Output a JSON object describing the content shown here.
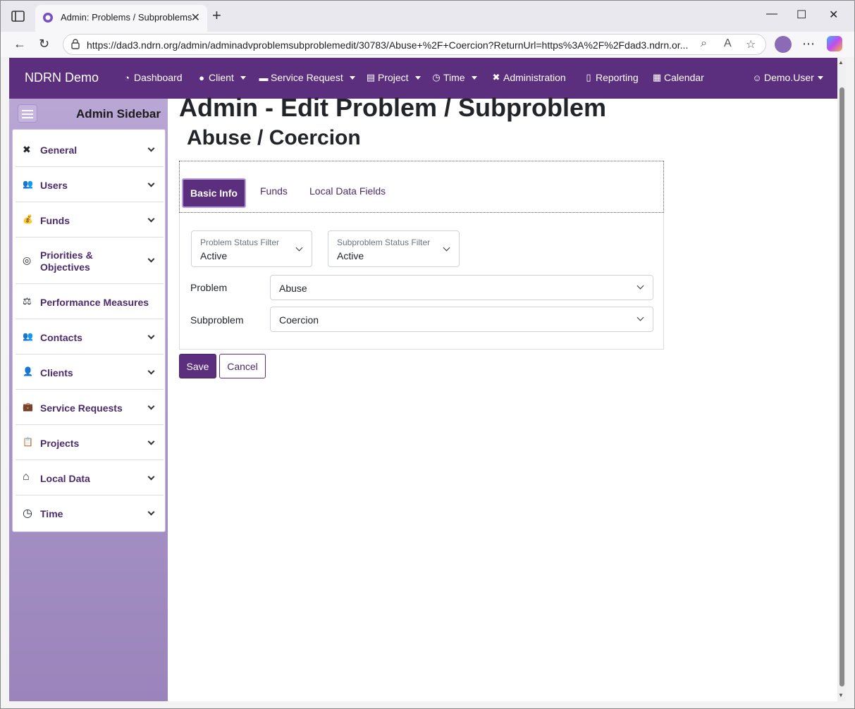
{
  "browser": {
    "tab_title": "Admin: Problems / Subproblems",
    "url": "https://dad3.ndrn.org/admin/adminadvproblemsubproblemedit/30783/Abuse+%2F+Coercion?ReturnUrl=https%3A%2F%2Fdad3.ndrn.or..."
  },
  "navbar": {
    "brand": "NDRN Demo",
    "items": [
      {
        "label": "Dashboard",
        "icon": "dashboard-icon",
        "glyph": "◔",
        "dropdown": false
      },
      {
        "label": "Client",
        "icon": "user-icon",
        "glyph": "●",
        "dropdown": true
      },
      {
        "label": "Service Request",
        "icon": "briefcase-icon",
        "glyph": "▬",
        "dropdown": true
      },
      {
        "label": "Project",
        "icon": "clipboard-icon",
        "glyph": "▤",
        "dropdown": true
      },
      {
        "label": "Time",
        "icon": "clock-icon",
        "glyph": "◷",
        "dropdown": true
      },
      {
        "label": "Administration",
        "icon": "tools-icon",
        "glyph": "✖",
        "dropdown": false
      },
      {
        "label": "Reporting",
        "icon": "file-icon",
        "glyph": "▯",
        "dropdown": false
      },
      {
        "label": "Calendar",
        "icon": "calendar-icon",
        "glyph": "▦",
        "dropdown": false
      }
    ],
    "user": "Demo.User"
  },
  "sidebar": {
    "title": "Admin Sidebar",
    "items": [
      {
        "label": "General",
        "icon": "tools-icon",
        "glyph": "✖",
        "chevron": true
      },
      {
        "label": "Users",
        "icon": "users-icon",
        "glyph": "👥",
        "chevron": true
      },
      {
        "label": "Funds",
        "icon": "money-bag-icon",
        "glyph": "💰",
        "chevron": true
      },
      {
        "label": "Priorities & Objectives",
        "icon": "target-icon",
        "glyph": "◎",
        "chevron": true
      },
      {
        "label": "Performance Measures",
        "icon": "scale-icon",
        "glyph": "⚖",
        "chevron": false
      },
      {
        "label": "Contacts",
        "icon": "users-icon",
        "glyph": "👥",
        "chevron": true
      },
      {
        "label": "Clients",
        "icon": "user-icon",
        "glyph": "👤",
        "chevron": true
      },
      {
        "label": "Service Requests",
        "icon": "briefcase-icon",
        "glyph": "💼",
        "chevron": true
      },
      {
        "label": "Projects",
        "icon": "clipboard-icon",
        "glyph": "📋",
        "chevron": true
      },
      {
        "label": "Local Data",
        "icon": "home-icon",
        "glyph": "⌂",
        "chevron": true
      },
      {
        "label": "Time",
        "icon": "clock-icon",
        "glyph": "◷",
        "chevron": true
      }
    ]
  },
  "page": {
    "title": "Admin - Edit Problem / Subproblem",
    "subtitle": "Abuse / Coercion"
  },
  "tabs": [
    "Basic Info",
    "Funds",
    "Local Data Fields"
  ],
  "form": {
    "problem_status_filter": {
      "label": "Problem Status Filter",
      "value": "Active"
    },
    "subproblem_status_filter": {
      "label": "Subproblem Status Filter",
      "value": "Active"
    },
    "problem": {
      "label": "Problem",
      "value": "Abuse"
    },
    "subproblem": {
      "label": "Subproblem",
      "value": "Coercion"
    }
  },
  "actions": {
    "save": "Save",
    "cancel": "Cancel"
  },
  "colors": {
    "primary": "#5b2f7d",
    "sidebar_top": "#b9a6d5",
    "sidebar_bottom": "#9a84bb",
    "accent_border": "#b79ae0"
  }
}
